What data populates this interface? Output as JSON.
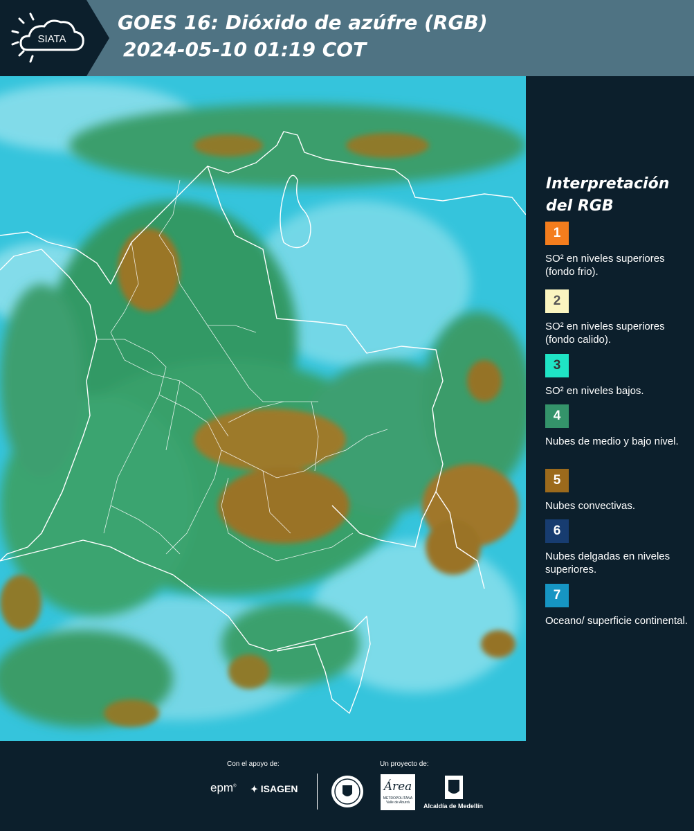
{
  "header": {
    "logo_text": "SIATA",
    "title_line1": "GOES 16: Dióxido de azúfre (RGB)",
    "title_line2": "2024-05-10 01:19 COT"
  },
  "legend": {
    "title": "Interpretación del RGB",
    "items": [
      {
        "number": "1",
        "text": "SO² en niveles superiores (fondo frio).",
        "color": "#f47d1d",
        "number_color": "#ffffff"
      },
      {
        "number": "2",
        "text": "SO² en niveles superiores (fondo calido).",
        "color": "#fbf5c0",
        "number_color": "#555555"
      },
      {
        "number": "3",
        "text": "SO² en niveles bajos.",
        "color": "#1fe4c5",
        "number_color": "#333333"
      },
      {
        "number": "4",
        "text": "Nubes de medio y bajo nivel.",
        "color": "#34936a",
        "number_color": "#ffffff"
      },
      {
        "number": "5",
        "text": "Nubes convectivas.",
        "color": "#9c6a1c",
        "number_color": "#ffffff"
      },
      {
        "number": "6",
        "text": "Nubes delgadas en niveles superiores.",
        "color": "#173c70",
        "number_color": "#ffffff"
      },
      {
        "number": "7",
        "text": "Oceano/ superficie continental.",
        "color": "#1695c3",
        "number_color": "#ffffff"
      }
    ]
  },
  "footer": {
    "support_label": "Con el apoyo de:",
    "project_label": "Un proyecto de:",
    "sponsor_epm": "epm",
    "sponsor_isagen": "ISAGEN",
    "area_text": "Área",
    "area_subtext": "METROPOLITANA",
    "area_subtext2": "Valle de Aburrá",
    "alcaldia": "Alcaldía de Medellín"
  },
  "colors": {
    "header_bg": "#4f7383",
    "page_bg": "#0c1f2c",
    "map_ocean": "#34c6de",
    "map_land": "#2f9a66",
    "map_convective": "#9a7326"
  }
}
